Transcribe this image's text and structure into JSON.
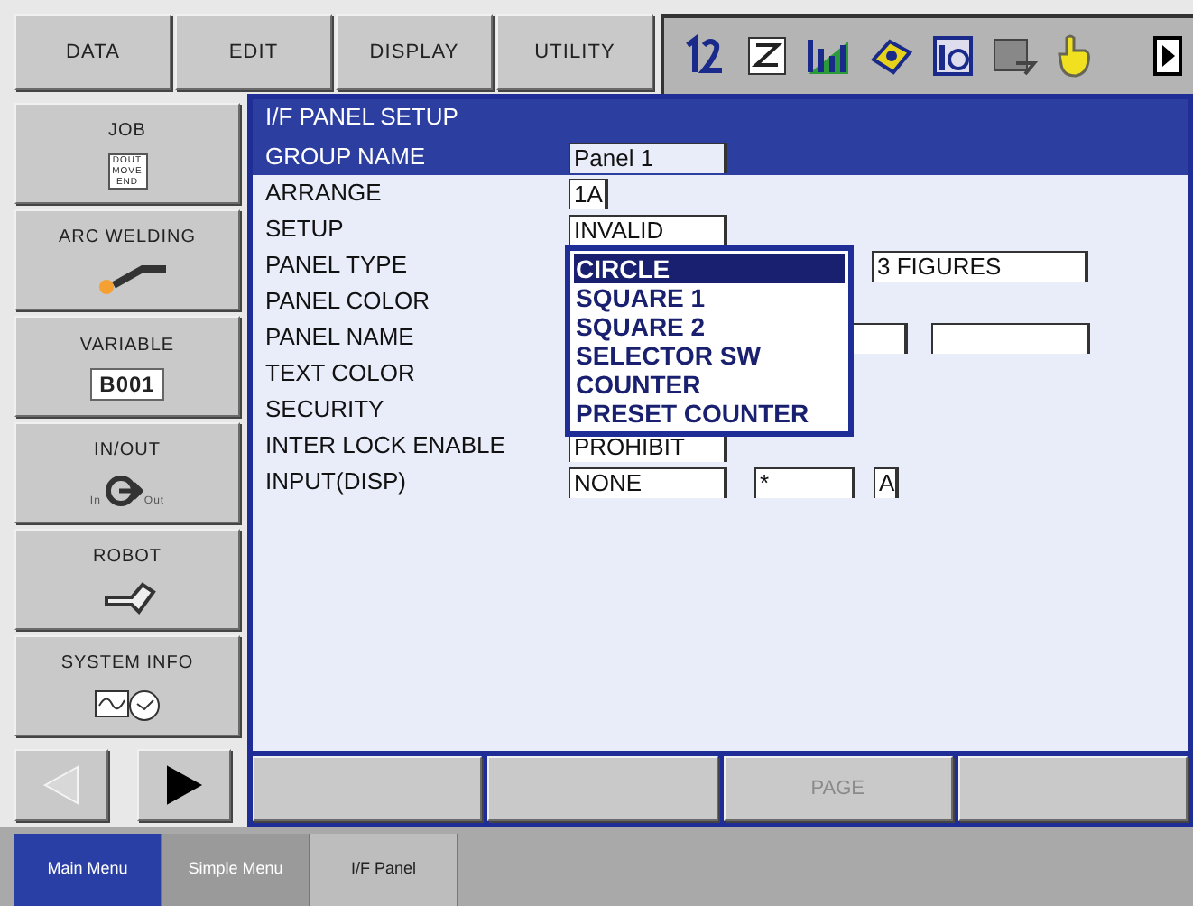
{
  "top_menu": [
    {
      "label": "DATA"
    },
    {
      "label": "EDIT"
    },
    {
      "label": "DISPLAY"
    },
    {
      "label": "UTILITY"
    }
  ],
  "toolbar_icons": [
    {
      "kind": "numbers"
    },
    {
      "kind": "edit"
    },
    {
      "kind": "chart"
    },
    {
      "kind": "tool"
    },
    {
      "kind": "io"
    },
    {
      "kind": "screen"
    },
    {
      "kind": "hand"
    },
    {
      "kind": "next"
    }
  ],
  "sidebar": [
    {
      "label": "JOB",
      "kind": "job",
      "icon_text": [
        "DOUT",
        "MOVE",
        "END"
      ]
    },
    {
      "label": "ARC WELDING",
      "kind": "arc"
    },
    {
      "label": "VARIABLE",
      "kind": "variable",
      "icon_text": [
        "B001"
      ]
    },
    {
      "label": "IN/OUT",
      "kind": "inout",
      "icon_text": [
        "In",
        "Out"
      ]
    },
    {
      "label": "ROBOT",
      "kind": "robot"
    },
    {
      "label": "SYSTEM INFO",
      "kind": "sysinfo"
    }
  ],
  "page_arrows": [
    {
      "kind": "left",
      "disabled": true
    },
    {
      "kind": "right",
      "disabled": false
    }
  ],
  "panel": {
    "title": "I/F PANEL SETUP",
    "rows": [
      {
        "label": "GROUP NAME",
        "highlighted": true,
        "fields": [
          {
            "kind": "normal",
            "value": "Panel 1"
          }
        ]
      },
      {
        "label": "ARRANGE",
        "highlighted": false,
        "fields": [
          {
            "kind": "short",
            "value": "1A"
          }
        ]
      },
      {
        "label": "SETUP",
        "highlighted": false,
        "fields": [
          {
            "kind": "normal",
            "value": "INVALID"
          }
        ]
      },
      {
        "label": "PANEL TYPE",
        "highlighted": false,
        "fields": [
          {
            "kind": "offset-wide",
            "value": "3 FIGURES"
          }
        ]
      },
      {
        "label": "PANEL COLOR",
        "highlighted": false,
        "fields": []
      },
      {
        "label": "PANEL NAME",
        "highlighted": false,
        "fields": [
          {
            "kind": "stub"
          },
          {
            "kind": "wide"
          }
        ]
      },
      {
        "label": "TEXT COLOR",
        "highlighted": false,
        "fields": []
      },
      {
        "label": "SECURITY",
        "highlighted": false,
        "fields": []
      },
      {
        "label": "INTER LOCK ENABLE",
        "highlighted": false,
        "fields": [
          {
            "kind": "normal",
            "value": "PROHIBIT"
          }
        ]
      },
      {
        "label": "INPUT(DISP)",
        "highlighted": false,
        "fields": [
          {
            "kind": "normal",
            "value": "NONE"
          },
          {
            "kind": "medium",
            "value": "*"
          },
          {
            "kind": "tiny",
            "value": "A"
          }
        ]
      }
    ],
    "dropdown": [
      {
        "label": "CIRCLE",
        "selected": true
      },
      {
        "label": "SQUARE 1",
        "selected": false
      },
      {
        "label": "SQUARE 2",
        "selected": false
      },
      {
        "label": "SELECTOR SW",
        "selected": false
      },
      {
        "label": "COUNTER",
        "selected": false
      },
      {
        "label": "PRESET COUNTER",
        "selected": false
      }
    ]
  },
  "function_keys": [
    {
      "kind": "blank"
    },
    {
      "kind": "blank"
    },
    {
      "kind": "labeled",
      "label": "PAGE",
      "disabled": true
    },
    {
      "kind": "blank"
    }
  ],
  "bottom_tabs": [
    {
      "label": "Main Menu",
      "selected": true,
      "disabled": false
    },
    {
      "label": "Simple Menu",
      "selected": false,
      "disabled": true
    },
    {
      "label": "I/F Panel",
      "selected": false,
      "disabled": false
    }
  ]
}
